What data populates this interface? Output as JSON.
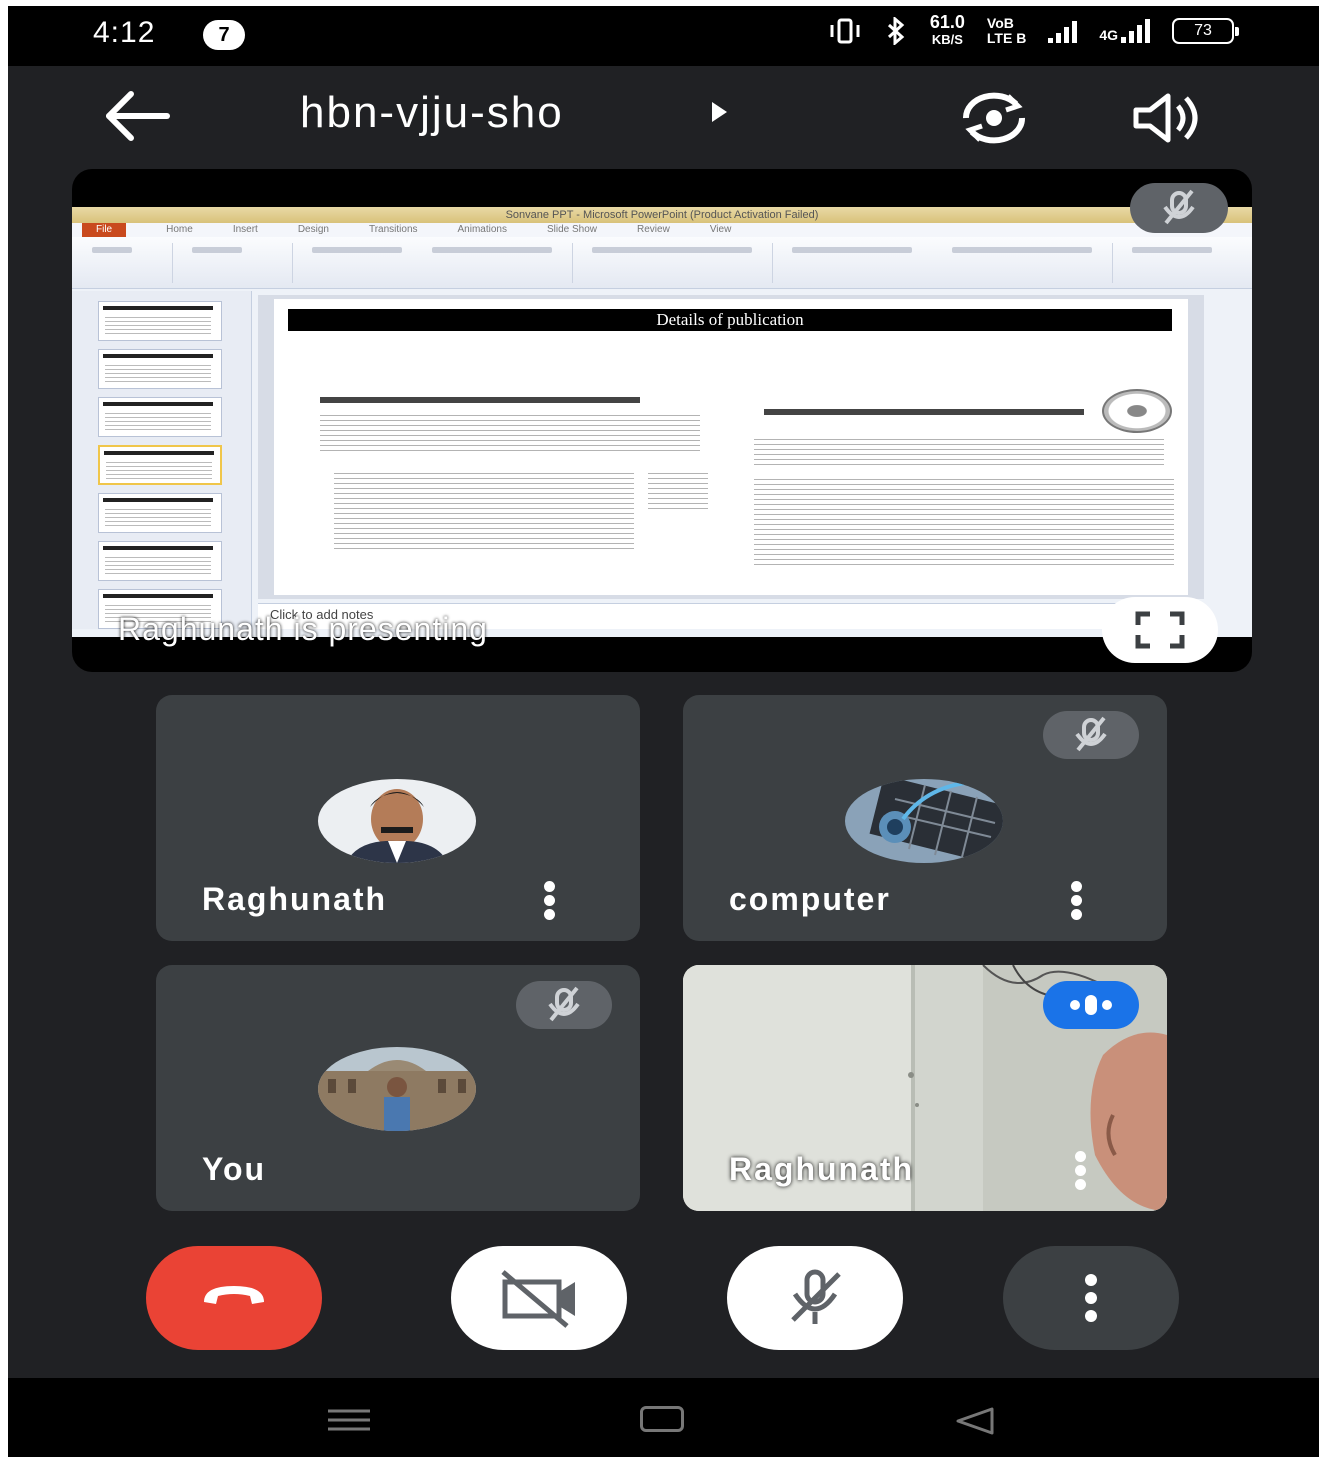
{
  "status_bar": {
    "time": "4:12",
    "notification_count": "7",
    "speed_value": "61.0",
    "speed_unit": "KB/S",
    "volte_top": "VoB",
    "volte_bottom": "LTE B",
    "network_type": "4G",
    "battery_level": "73"
  },
  "header": {
    "meeting_code": "hbn-vjju-sho",
    "icons": [
      "back-arrow-icon",
      "play-arrow-icon",
      "switch-camera-icon",
      "speaker-icon"
    ]
  },
  "presentation": {
    "window_title": "Sonvane PPT - Microsoft PowerPoint (Product Activation Failed)",
    "ribbon_tabs": [
      "File",
      "Home",
      "Insert",
      "Design",
      "Transitions",
      "Animations",
      "Slide Show",
      "Review",
      "View"
    ],
    "slide_heading": "Details of publication",
    "notes_placeholder": "Click to add notes",
    "presenting_label": "Raghunath is presenting",
    "mic_muted": true
  },
  "participants": [
    {
      "name": "Raghunath",
      "muted": false,
      "has_video": false
    },
    {
      "name": "computer",
      "muted": true,
      "has_video": false
    },
    {
      "name": "You",
      "muted": true,
      "has_video": false
    },
    {
      "name": "Raghunath",
      "muted": false,
      "has_video": true,
      "speaking": true
    }
  ],
  "controls": [
    "end-call",
    "camera-off",
    "mic-off",
    "more-options"
  ],
  "colors": {
    "background": "#202124",
    "tile": "#3c4043",
    "end_call": "#ea4335",
    "speaking_indicator": "#1a73e8",
    "mute_pill": "#5f6368"
  }
}
